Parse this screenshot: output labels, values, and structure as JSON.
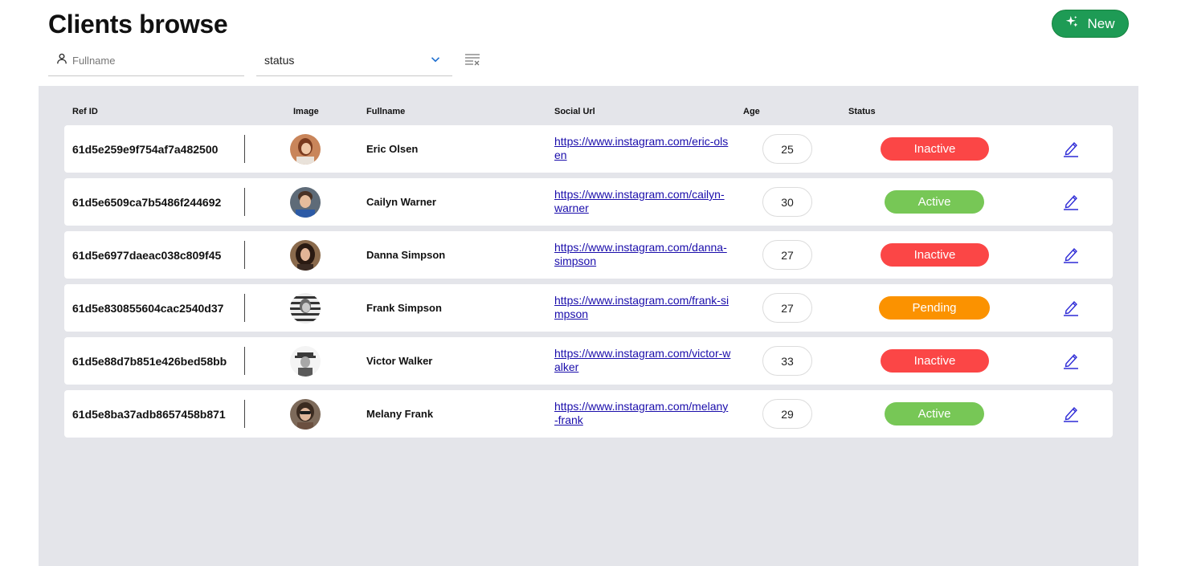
{
  "header": {
    "title": "Clients browse",
    "new_button_label": "New",
    "new_button_icon": "sparkle-icon"
  },
  "filters": {
    "fullname_placeholder": "Fullname",
    "status_value": "status",
    "clear_icon": "clear-filter-icon"
  },
  "table": {
    "columns": {
      "ref_id": "Ref ID",
      "image": "Image",
      "fullname": "Fullname",
      "social_url": "Social Url",
      "age": "Age",
      "status": "Status"
    },
    "rows": [
      {
        "ref_id": "61d5e259e9f754af7a482500",
        "fullname": "Eric Olsen",
        "social_url": "https://www.instagram.com/eric-olsen",
        "age": "25",
        "status": "Inactive"
      },
      {
        "ref_id": "61d5e6509ca7b5486f244692",
        "fullname": "Cailyn Warner",
        "social_url": "https://www.instagram.com/cailyn-warner",
        "age": "30",
        "status": "Active"
      },
      {
        "ref_id": "61d5e6977daeac038c809f45",
        "fullname": "Danna Simpson",
        "social_url": "https://www.instagram.com/danna-simpson",
        "age": "27",
        "status": "Inactive"
      },
      {
        "ref_id": "61d5e830855604cac2540d37",
        "fullname": "Frank Simpson",
        "social_url": "https://www.instagram.com/frank-simpson",
        "age": "27",
        "status": "Pending"
      },
      {
        "ref_id": "61d5e88d7b851e426bed58bb",
        "fullname": "Victor Walker",
        "social_url": "https://www.instagram.com/victor-walker",
        "age": "33",
        "status": "Inactive"
      },
      {
        "ref_id": "61d5e8ba37adb8657458b871",
        "fullname": "Melany Frank",
        "social_url": "https://www.instagram.com/melany-frank",
        "age": "29",
        "status": "Active"
      }
    ]
  },
  "colors": {
    "accent_green": "#1e9b55",
    "status_inactive": "#fb4646",
    "status_active": "#77c756",
    "status_pending": "#fb9200",
    "table_background": "#e4e5ea",
    "link": "#1a0dab",
    "edit_icon": "#2d2ad6"
  }
}
